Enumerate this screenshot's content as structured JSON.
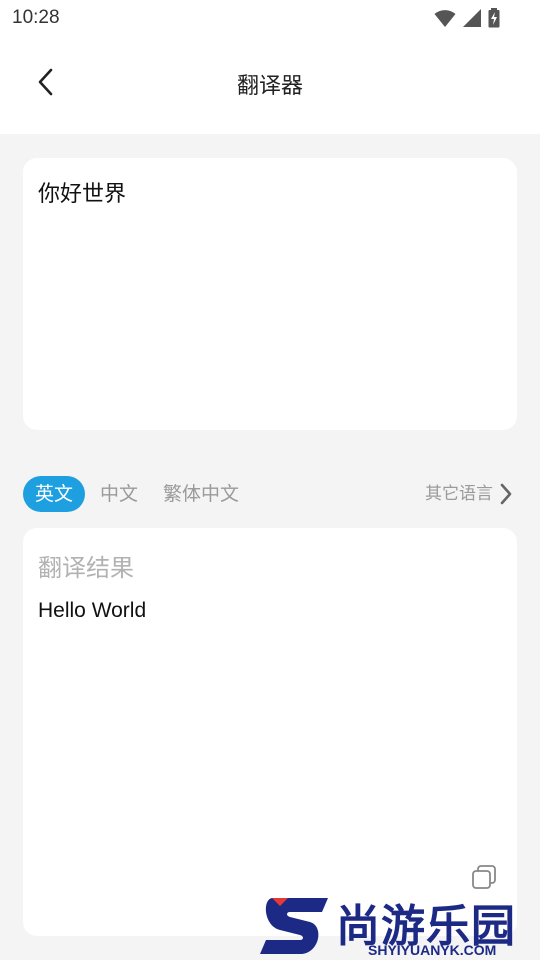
{
  "status": {
    "time": "10:28"
  },
  "header": {
    "title": "翻译器"
  },
  "input": {
    "text": "你好世界"
  },
  "languages": {
    "tabs": [
      {
        "label": "英文",
        "selected": true
      },
      {
        "label": "中文",
        "selected": false
      },
      {
        "label": "繁体中文",
        "selected": false
      }
    ],
    "other": "其它语言"
  },
  "result": {
    "label": "翻译结果",
    "text": "Hello World"
  },
  "colors": {
    "accent": "#1e9fe0",
    "background": "#f4f4f4"
  },
  "watermark": {
    "brand_cn": "尚游乐园",
    "brand_en": "SHYIYUANYK.COM"
  }
}
